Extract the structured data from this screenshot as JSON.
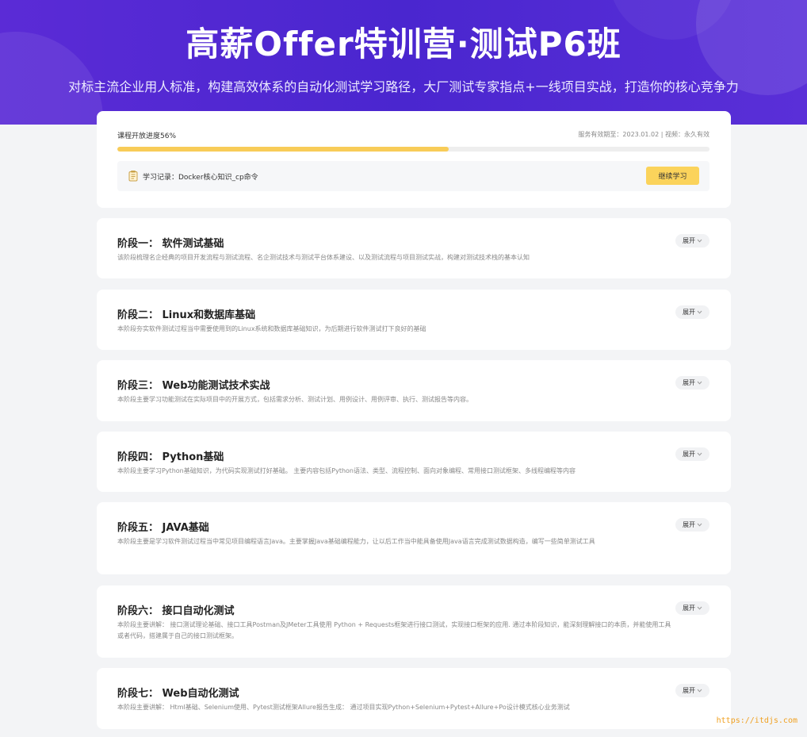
{
  "hero": {
    "title": "高薪Offer特训营·测试P6班",
    "subtitle": "对标主流企业用人标准，构建高效体系的自动化测试学习路径，大厂测试专家指点+一线项目实战，打造你的核心竞争力"
  },
  "progress": {
    "label": "课程开放进度56%",
    "percent": 56,
    "validity": "服务有效期至：2023.01.02 | 视频：永久有效",
    "record_text": "学习记录：Docker核心知识_cp命令",
    "continue_label": "继续学习",
    "accent_color": "#f8cc58"
  },
  "expand_label": "展开",
  "stages": [
    {
      "title": "阶段一：  软件测试基础",
      "desc": "该阶段梳理名企经典的项目开发流程与测试流程、名企测试技术与测试平台体系建设、以及测试流程与项目测试实战，构建对测试技术栈的基本认知"
    },
    {
      "title": "阶段二：  Linux和数据库基础",
      "desc": "本阶段夯实软件测试过程当中需要使用到的Linux系统和数据库基础知识，为后期进行软件测试打下良好的基础"
    },
    {
      "title": "阶段三：  Web功能测试技术实战",
      "desc": "本阶段主要学习功能测试在实际项目中的开展方式，包括需求分析、测试计划、用例设计、用例评审、执行、测试报告等内容。"
    },
    {
      "title": "阶段四：  Python基础",
      "desc": "本阶段主要学习Python基础知识，为代码实现测试打好基础。 主要内容包括Python语法、类型、流程控制、面向对象编程、常用接口测试框架、多线程编程等内容"
    },
    {
      "title": "阶段五：  JAVA基础",
      "desc": "本阶段主要是学习软件测试过程当中常见项目编程语言Java。主要掌握Java基础编程能力，让以后工作当中能具备使用Java语言完成测试数据构造，编写一些简单测试工具"
    },
    {
      "title": "阶段六：  接口自动化测试",
      "desc": "本阶段主要讲解：  接口测试理论基础、接口工具Postman及JMeter工具使用 Python + Requests框架进行接口测试，实现接口框架的应用. 通过本阶段知识，能深刻理解接口的本质，并能使用工具或者代码，搭建属于自己的接口测试框架。"
    },
    {
      "title": "阶段七：  Web自动化测试",
      "desc": "本阶段主要讲解：  Html基础、Selenium使用、Pytest测试框架Allure报告生成：  通过项目实现Python+Selenium+Pytest+Allure+Po设计模式核心业务测试"
    }
  ],
  "watermark": "https://itdjs.com"
}
